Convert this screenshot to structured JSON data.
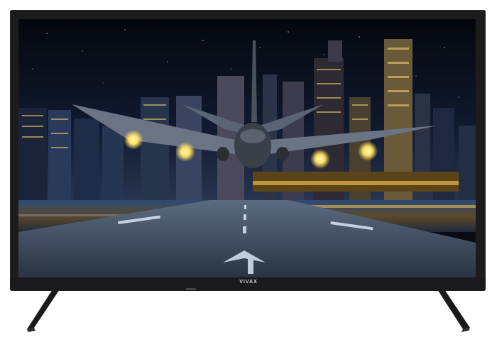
{
  "brand": {
    "logo_text": "VIVAX"
  },
  "scene": {
    "subject": "airplane-on-runway",
    "background": "city-skyline-at-night",
    "colors": {
      "bezel": "#1c1c1e",
      "sky": "#0b1020",
      "runway": "#3d4a5c",
      "lights": "#ffd86a"
    }
  }
}
